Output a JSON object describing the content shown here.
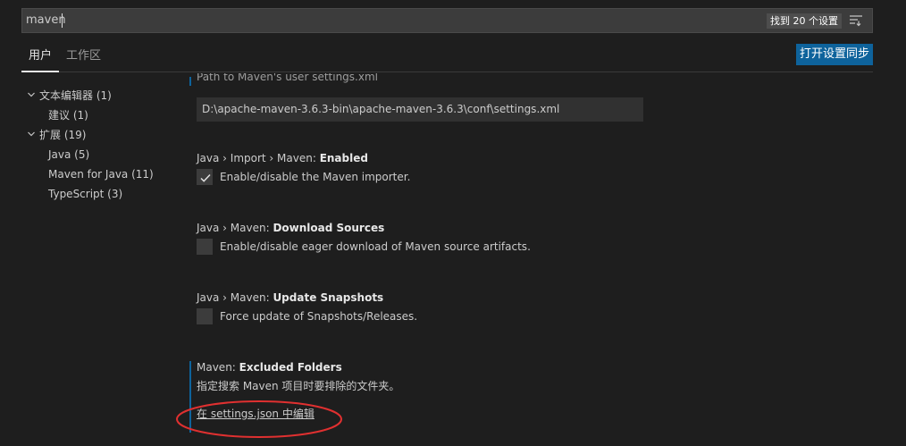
{
  "search": {
    "value": "maven",
    "result_count": "找到 20 个设置"
  },
  "tabs": {
    "user": "用户",
    "workspace": "工作区"
  },
  "sync_button": "打开设置同步",
  "toc": [
    {
      "label": "文本编辑器 (1)",
      "expanded": true
    },
    {
      "label": "建议 (1)"
    },
    {
      "label": "扩展 (19)",
      "expanded": true
    },
    {
      "label": "Java (5)"
    },
    {
      "label": "Maven for Java (11)"
    },
    {
      "label": "TypeScript (3)"
    }
  ],
  "settings": {
    "user_settings_path": {
      "desc_cut": "Path to Maven's user settings.xml",
      "value": "D:\\apache-maven-3.6.3-bin\\apache-maven-3.6.3\\conf\\settings.xml"
    },
    "import_enabled": {
      "prefix": "Java › Import › Maven: ",
      "name": "Enabled",
      "desc": "Enable/disable the Maven importer.",
      "checked": true
    },
    "download_sources": {
      "prefix": "Java › Maven: ",
      "name": "Download Sources",
      "desc": "Enable/disable eager download of Maven source artifacts.",
      "checked": false
    },
    "update_snapshots": {
      "prefix": "Java › Maven: ",
      "name": "Update Snapshots",
      "desc": "Force update of Snapshots/Releases.",
      "checked": false
    },
    "excluded_folders": {
      "prefix": "Maven: ",
      "name": "Excluded Folders",
      "desc": "指定搜索 Maven 项目时要排除的文件夹。",
      "link": "在 settings.json 中编辑"
    }
  },
  "colors": {
    "background": "#1e1e1e",
    "accent": "#0e639c",
    "annotation": "#e03030"
  }
}
